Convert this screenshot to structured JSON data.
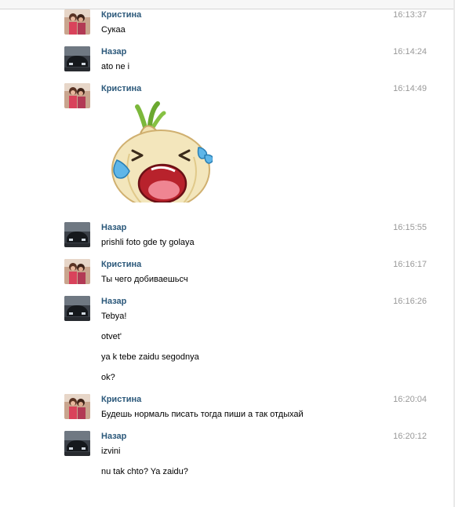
{
  "messages": [
    {
      "author": "Кристина",
      "time": "16:13:37",
      "lines": [
        "Сукаа"
      ]
    },
    {
      "author": "Назар",
      "time": "16:14:24",
      "lines": [
        "ato ne i"
      ]
    },
    {
      "author": "Кристина",
      "time": "16:14:49",
      "sticker": "crying-onion-sticker"
    },
    {
      "author": "Назар",
      "time": "16:15:55",
      "lines": [
        "prishli foto gde ty golaya"
      ]
    },
    {
      "author": "Кристина",
      "time": "16:16:17",
      "lines": [
        "Ты чего добиваешьсч"
      ]
    },
    {
      "author": "Назар",
      "time": "16:16:26",
      "lines": [
        "Tebya!",
        "otvet'",
        "ya k tebe zaidu segodnya",
        "ok?"
      ]
    },
    {
      "author": "Кристина",
      "time": "16:20:04",
      "lines": [
        "Будешь нормаль писать тогда пиши а так отдыхай"
      ]
    },
    {
      "author": "Назар",
      "time": "16:20:12",
      "lines": [
        "izvini",
        "nu tak chto? Ya zaidu?"
      ]
    }
  ],
  "colors": {
    "author": "#2b587a",
    "time": "#999999",
    "text": "#000000"
  }
}
